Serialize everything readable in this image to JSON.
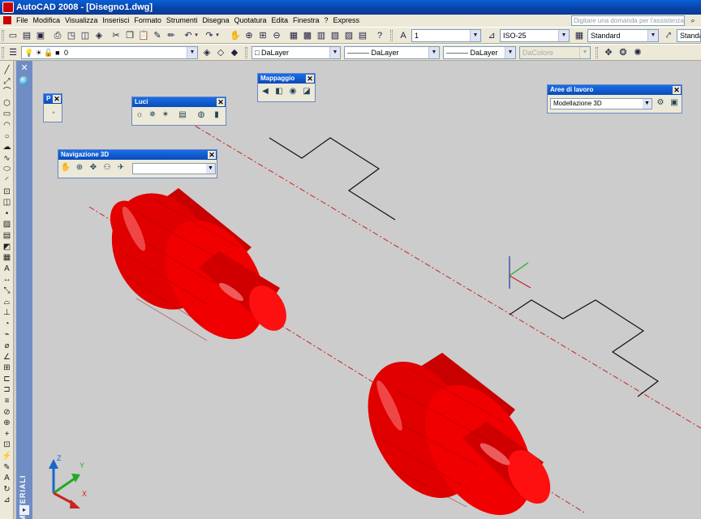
{
  "window": {
    "title": "AutoCAD 2008 - [Disegno1.dwg]"
  },
  "menu": [
    "File",
    "Modifica",
    "Visualizza",
    "Inserisci",
    "Formato",
    "Strumenti",
    "Disegna",
    "Quotatura",
    "Edita",
    "Finestra",
    "?",
    "Express"
  ],
  "help": {
    "placeholder": "Digitare una domanda per l'assistenza"
  },
  "toolbar_std": {
    "text_style_value": "1",
    "dim_style_value": "ISO-25",
    "table_style_value": "Standard",
    "multileader_style_value": "Standard"
  },
  "toolbar_layers": {
    "layer_value": "0",
    "color_value": "DaLayer",
    "linetype_value": "DaLayer",
    "lineweight_value": "DaLayer",
    "plotstyle_value": "DaColore"
  },
  "panels": {
    "p_small": {
      "title": "P"
    },
    "luci": {
      "title": "Luci"
    },
    "mappaggio": {
      "title": "Mappaggio"
    },
    "navigazione": {
      "title": "Navigazione 3D",
      "combo_value": ""
    },
    "aree": {
      "title": "Aree di lavoro",
      "combo_value": "Modellazione 3D"
    }
  },
  "palette": {
    "label": "MATERIALI"
  },
  "ucs": {
    "x": "X",
    "y": "Y",
    "z": "Z"
  },
  "colors": {
    "solid": "#e00000",
    "centerline": "#cc2222",
    "background": "#cccccc"
  }
}
